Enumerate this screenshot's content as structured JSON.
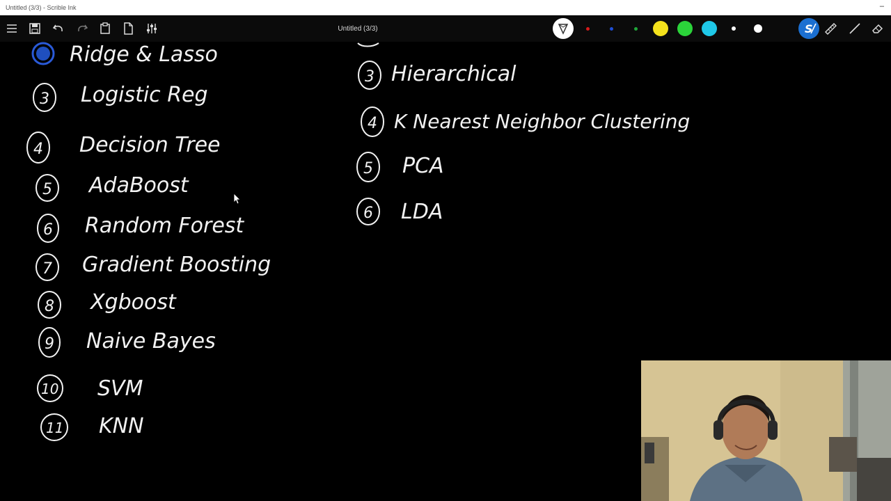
{
  "window": {
    "title": "Untitled (3/3) - Scrible Ink",
    "minimize_glyph": "–"
  },
  "toolbar": {
    "doc_title": "Untitled (3/3)",
    "left_icons": [
      "menu-icon",
      "save-icon",
      "undo-icon",
      "redo-icon",
      "clipboard-icon",
      "new-page-icon",
      "settings-sliders-icon"
    ],
    "right_icons": [
      "pen-tool-icon",
      "ruler-icon",
      "line-icon",
      "eraser-icon"
    ],
    "colors": {
      "red": "#d81b1b",
      "blue": "#1e4fd8",
      "green": "#1fa83a",
      "yellow": "#f5e21c",
      "lime": "#2bd43a",
      "cyan": "#1fc8e8",
      "white": "#ffffff",
      "accent": "#1b6fd1"
    }
  },
  "canvas": {
    "left_list": [
      {
        "num": "",
        "label": "Ridge & Lasso"
      },
      {
        "num": "3",
        "label": "Logistic Reg"
      },
      {
        "num": "4",
        "label": "Decision Tree"
      },
      {
        "num": "5",
        "label": "AdaBoost"
      },
      {
        "num": "6",
        "label": "Random Forest"
      },
      {
        "num": "7",
        "label": "Gradient Boosting"
      },
      {
        "num": "8",
        "label": "Xgboost"
      },
      {
        "num": "9",
        "label": "Naive Bayes"
      },
      {
        "num": "10",
        "label": "SVM"
      },
      {
        "num": "11",
        "label": "KNN"
      }
    ],
    "right_list": [
      {
        "num": "3",
        "label": "Hierarchical"
      },
      {
        "num": "4",
        "label": "K Nearest Neighbor Clustering"
      },
      {
        "num": "5",
        "label": "PCA"
      },
      {
        "num": "6",
        "label": "LDA"
      }
    ]
  }
}
